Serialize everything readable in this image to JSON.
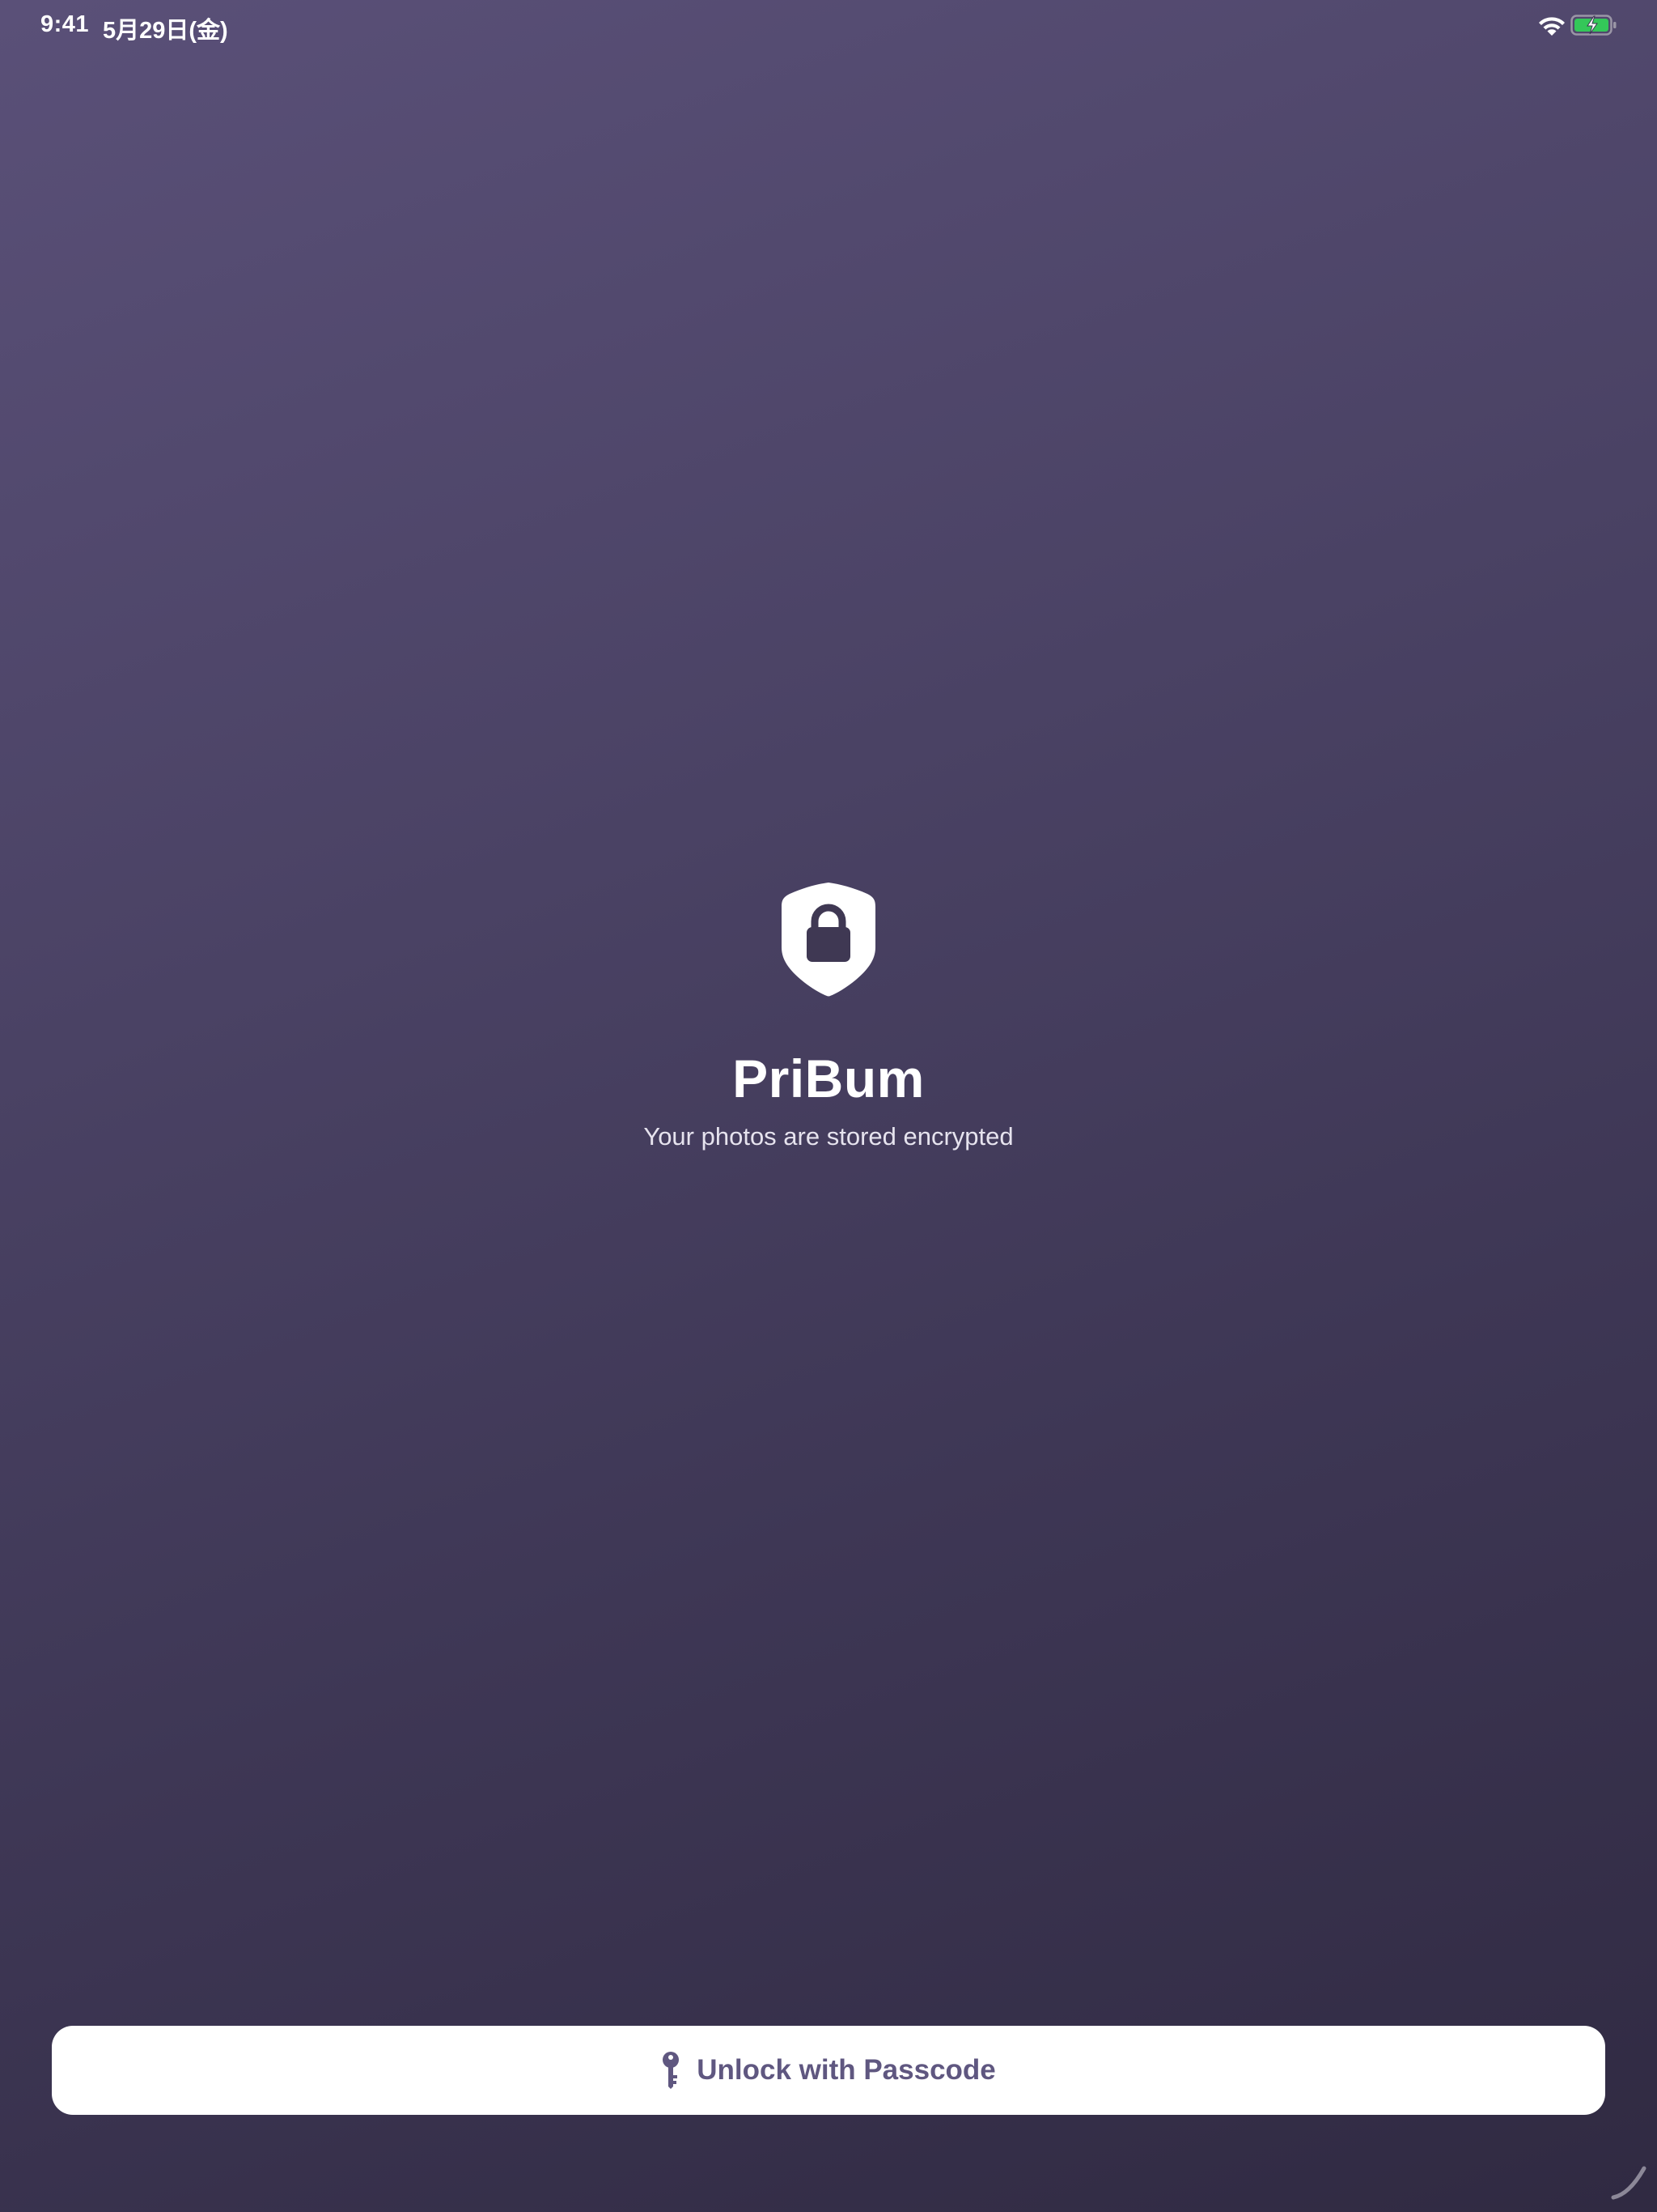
{
  "status_bar": {
    "time": "9:41",
    "date": "5月29日(金)",
    "icons": [
      "wifi-icon",
      "battery-charging-icon"
    ]
  },
  "app": {
    "icon": "lock-shield-icon",
    "title": "PriBum",
    "subtitle": "Your photos are stored encrypted"
  },
  "unlock_button": {
    "icon": "key-icon",
    "label": "Unlock with Passcode"
  },
  "colors": {
    "background_top": "#5a5078",
    "background_bottom": "#302a42",
    "accent": "#5f5780",
    "battery_fill": "#34c759"
  }
}
